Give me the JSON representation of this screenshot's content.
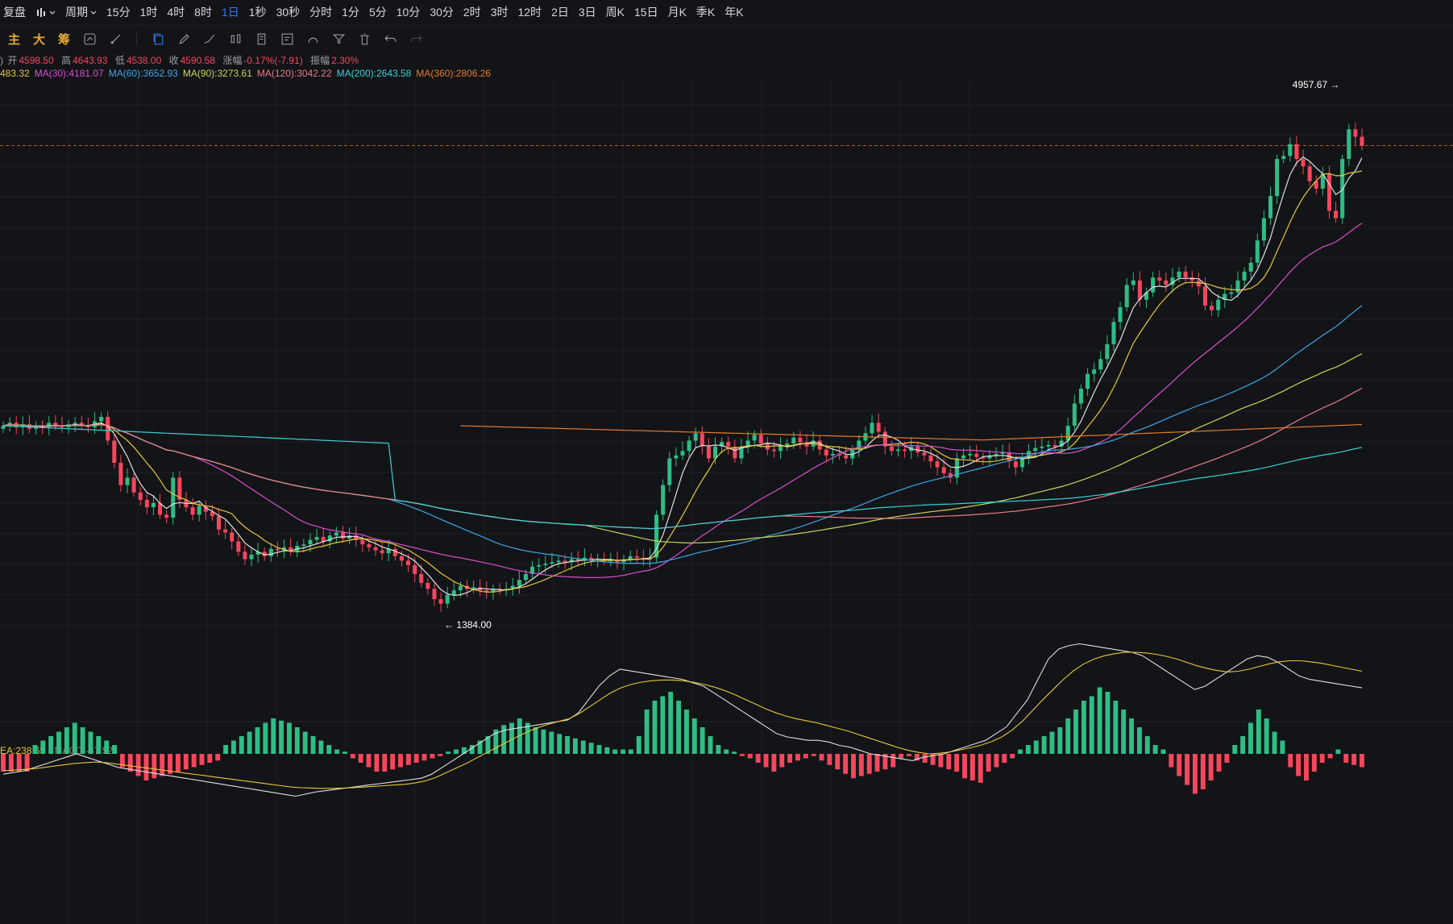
{
  "topbar": {
    "replay_label": "复盘",
    "period_label": "周期",
    "intervals": [
      "15分",
      "1时",
      "4时",
      "8时",
      "1日",
      "1秒",
      "30秒",
      "分时",
      "1分",
      "5分",
      "10分",
      "30分",
      "2时",
      "3时",
      "12时",
      "2日",
      "3日",
      "周K",
      "15日",
      "月K",
      "季K",
      "年K"
    ],
    "active_interval": "1日"
  },
  "toolbar": {
    "indicators": [
      "主",
      "大",
      "筹"
    ]
  },
  "ohlc": {
    "open_label": "开",
    "open": "4598.50",
    "high_label": "高",
    "high": "4643.93",
    "low_label": "低",
    "low": "4538.00",
    "close_label": "收",
    "close": "4590.58",
    "change_label": "涨幅",
    "change": "-0.17%(-7.91)",
    "amp_label": "振幅",
    "amp": "2.30%"
  },
  "ma": [
    {
      "label": "483.32",
      "color": "#e8c63a"
    },
    {
      "label": "MA(30):4181.07",
      "color": "#d94fd0"
    },
    {
      "label": "MA(60):3652.93",
      "color": "#3ea6e8"
    },
    {
      "label": "MA(90):3273.61",
      "color": "#c8d45a"
    },
    {
      "label": "MA(120):3042.22",
      "color": "#e87a8a"
    },
    {
      "label": "MA(200):2643.58",
      "color": "#3ad1d8"
    },
    {
      "label": "MA(360):2806.26",
      "color": "#e87a2a"
    }
  ],
  "macd": {
    "dea_label": "EA:238.65",
    "macd_label": "MACD:-37.52"
  },
  "colors": {
    "up": "#2ebd85",
    "down": "#f6465d",
    "white_line": "#e0e0e0",
    "ma_short": "#e8c63a",
    "ma30": "#d94fd0",
    "ma60": "#3ea6e8",
    "ma90": "#c8d45a",
    "ma120": "#e87a8a",
    "ma200": "#3ad1d8",
    "ma360": "#e87a2a"
  },
  "chart_data": {
    "type": "candlestick",
    "high_marker": "4957.67",
    "low_marker": "1384.00",
    "current_price": 4590.58,
    "price_min": 1384.0,
    "price_max": 4957.67,
    "closes": [
      2700,
      2720,
      2690,
      2710,
      2680,
      2700,
      2690,
      2720,
      2700,
      2690,
      2710,
      2720,
      2700,
      2690,
      2730,
      2760,
      2600,
      2450,
      2300,
      2350,
      2250,
      2200,
      2150,
      2180,
      2100,
      2080,
      2350,
      2200,
      2150,
      2100,
      2160,
      2120,
      2090,
      2000,
      1980,
      1920,
      1850,
      1800,
      1830,
      1850,
      1820,
      1870,
      1860,
      1880,
      1850,
      1890,
      1900,
      1930,
      1950,
      1920,
      1960,
      1980,
      1940,
      1960,
      1930,
      1900,
      1880,
      1860,
      1840,
      1870,
      1820,
      1790,
      1760,
      1700,
      1640,
      1600,
      1530,
      1500,
      1560,
      1590,
      1620,
      1600,
      1610,
      1590,
      1580,
      1600,
      1590,
      1600,
      1620,
      1660,
      1700,
      1750,
      1760,
      1770,
      1780,
      1790,
      1780,
      1800,
      1790,
      1810,
      1800,
      1800,
      1790,
      1790,
      1780,
      1800,
      1820,
      1810,
      1800,
      1810,
      2100,
      2300,
      2480,
      2500,
      2530,
      2600,
      2650,
      2560,
      2480,
      2560,
      2590,
      2560,
      2480,
      2560,
      2600,
      2640,
      2580,
      2540,
      2530,
      2560,
      2580,
      2620,
      2590,
      2560,
      2600,
      2540,
      2500,
      2510,
      2500,
      2480,
      2540,
      2600,
      2650,
      2720,
      2660,
      2560,
      2530,
      2540,
      2530,
      2560,
      2520,
      2500,
      2460,
      2420,
      2380,
      2350,
      2480,
      2500,
      2510,
      2490,
      2480,
      2500,
      2510,
      2520,
      2460,
      2420,
      2480,
      2530,
      2550,
      2560,
      2570,
      2560,
      2600,
      2700,
      2850,
      2950,
      3050,
      3080,
      3150,
      3250,
      3400,
      3500,
      3650,
      3680,
      3550,
      3600,
      3700,
      3680,
      3650,
      3700,
      3740,
      3700,
      3680,
      3640,
      3510,
      3480,
      3550,
      3590,
      3600,
      3680,
      3740,
      3800,
      3950,
      4100,
      4250,
      4500,
      4520,
      4600,
      4500,
      4450,
      4350,
      4300,
      4400,
      4150,
      4100,
      4500,
      4700,
      4650,
      4590
    ],
    "macd_hist": [
      -40,
      -40,
      -40,
      -40,
      20,
      30,
      40,
      50,
      60,
      70,
      60,
      50,
      40,
      30,
      20,
      -30,
      -40,
      -50,
      -60,
      -55,
      -50,
      -45,
      -40,
      -35,
      -30,
      -25,
      -20,
      -15,
      20,
      30,
      40,
      50,
      60,
      70,
      80,
      75,
      70,
      60,
      50,
      40,
      30,
      20,
      10,
      5,
      -10,
      -20,
      -30,
      -40,
      -40,
      -35,
      -30,
      -25,
      -20,
      -15,
      -10,
      -5,
      5,
      10,
      15,
      20,
      30,
      40,
      55,
      65,
      70,
      80,
      70,
      60,
      55,
      50,
      45,
      40,
      35,
      30,
      25,
      20,
      15,
      10,
      10,
      10,
      40,
      100,
      120,
      130,
      140,
      120,
      100,
      80,
      60,
      40,
      20,
      10,
      5,
      -5,
      -10,
      -20,
      -30,
      -40,
      -30,
      -20,
      -15,
      -10,
      -5,
      -15,
      -25,
      -35,
      -45,
      -55,
      -50,
      -45,
      -40,
      -35,
      -30,
      -10,
      -5,
      -15,
      -20,
      -25,
      -30,
      -35,
      -40,
      -55,
      -60,
      -65,
      -40,
      -30,
      -20,
      -10,
      10,
      20,
      30,
      40,
      50,
      60,
      80,
      100,
      120,
      130,
      150,
      140,
      120,
      100,
      80,
      60,
      40,
      20,
      10,
      -30,
      -50,
      -70,
      -90,
      -80,
      -60,
      -40,
      -20,
      20,
      40,
      70,
      100,
      80,
      50,
      30,
      -30,
      -50,
      -60,
      -40,
      -20,
      -10,
      10,
      -20,
      -25,
      -30
    ],
    "dif": [
      -60,
      -55,
      -50,
      -40,
      -30,
      -20,
      -10,
      0,
      -10,
      -20,
      -30,
      -40,
      -45,
      -50,
      -55,
      -60,
      -65,
      -70,
      -75,
      -80,
      -85,
      -90,
      -95,
      -100,
      -105,
      -110,
      -115,
      -120,
      -125,
      -118,
      -112,
      -108,
      -104,
      -100,
      -96,
      -92,
      -88,
      -84,
      -80,
      -76,
      -72,
      -60,
      -40,
      -20,
      0,
      20,
      40,
      60,
      70,
      75,
      80,
      85,
      90,
      95,
      100,
      120,
      160,
      200,
      230,
      250,
      245,
      240,
      235,
      230,
      225,
      220,
      210,
      200,
      180,
      160,
      140,
      120,
      100,
      80,
      60,
      50,
      45,
      40,
      40,
      35,
      25,
      20,
      10,
      0,
      -5,
      -10,
      -15,
      -20,
      -10,
      -5,
      0,
      10,
      20,
      30,
      40,
      60,
      80,
      120,
      160,
      220,
      280,
      310,
      320,
      325,
      320,
      315,
      310,
      305,
      300,
      290,
      270,
      250,
      230,
      210,
      190,
      200,
      220,
      240,
      260,
      280,
      290,
      285,
      270,
      250,
      230,
      220,
      215,
      210,
      205,
      200,
      195
    ],
    "dea": [
      -50,
      -48,
      -46,
      -44,
      -40,
      -36,
      -32,
      -28,
      -26,
      -24,
      -26,
      -30,
      -34,
      -38,
      -42,
      -46,
      -50,
      -54,
      -58,
      -62,
      -66,
      -70,
      -74,
      -78,
      -82,
      -86,
      -90,
      -94,
      -98,
      -100,
      -101,
      -102,
      -102,
      -101,
      -100,
      -98,
      -96,
      -94,
      -92,
      -90,
      -86,
      -80,
      -70,
      -56,
      -42,
      -28,
      -12,
      4,
      20,
      36,
      52,
      66,
      78,
      88,
      96,
      104,
      120,
      140,
      160,
      180,
      195,
      205,
      212,
      216,
      218,
      218,
      216,
      212,
      206,
      198,
      188,
      176,
      162,
      148,
      134,
      122,
      112,
      104,
      98,
      92,
      84,
      76,
      68,
      58,
      48,
      38,
      28,
      18,
      10,
      4,
      0,
      2,
      6,
      12,
      18,
      26,
      36,
      50,
      70,
      96,
      128,
      160,
      190,
      220,
      246,
      266,
      280,
      290,
      296,
      300,
      300,
      298,
      294,
      288,
      280,
      270,
      260,
      252,
      246,
      242,
      244,
      250,
      258,
      266,
      272,
      275,
      275,
      272,
      268,
      262,
      256,
      250,
      244
    ]
  }
}
